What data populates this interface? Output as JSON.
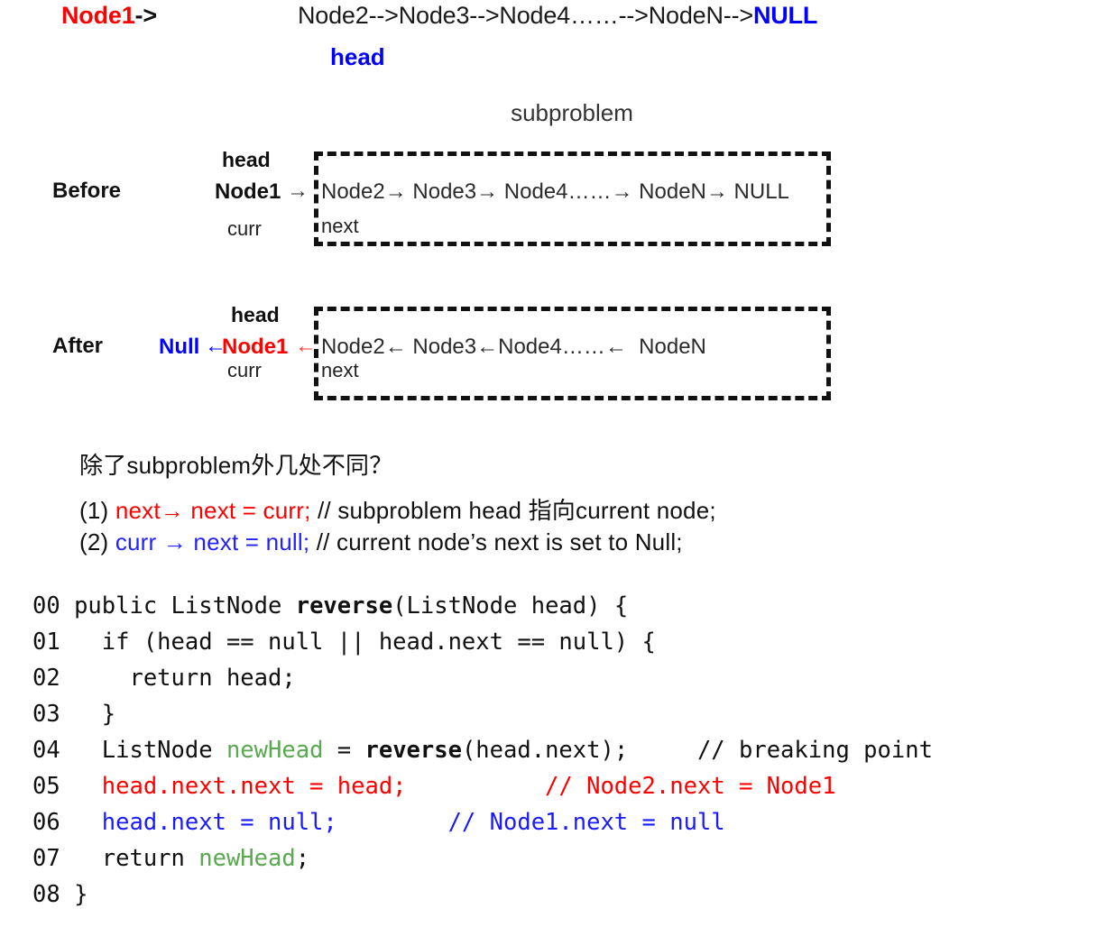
{
  "top_list": {
    "node1_label": "Node1",
    "node1_arrow": "->",
    "rest": "Node2-->Node3-->Node4……-->NodeN-->",
    "null_label": "NULL",
    "head_label": "head"
  },
  "diagram": {
    "subproblem_label": "subproblem",
    "before": {
      "row_label": "Before",
      "head_label": "head",
      "node1_label": "Node1",
      "arrow": "→",
      "curr_label": "curr",
      "chain": "Node2→ Node3→ Node4……→ NodeN→ NULL",
      "next_label": "next"
    },
    "after": {
      "row_label": "After",
      "head_label": "head",
      "null_label": "Null",
      "arrow_blue": "←",
      "node1_label": "Node1",
      "arrow_red": "←",
      "curr_label": "curr",
      "chain": "Node2← Node3←Node4……←  NodeN",
      "next_label": "next"
    }
  },
  "notes": {
    "question": "除了subproblem外几处不同？",
    "item1": {
      "index": "(1) ",
      "code": "next→ next = curr;",
      "comment": " // subproblem head 指向current node;"
    },
    "item2": {
      "index": "(2) ",
      "code": "curr → next = null;",
      "comment": " // current node’s next is set to Null;"
    }
  },
  "code": {
    "lines": [
      {
        "num": "00",
        "parts": [
          {
            "t": " public ListNode ",
            "c": "plain"
          },
          {
            "t": "reverse",
            "c": "bold"
          },
          {
            "t": "(ListNode head) {",
            "c": "plain"
          }
        ]
      },
      {
        "num": "01",
        "parts": [
          {
            "t": "   if (head == null || head.next == null) {",
            "c": "plain"
          }
        ]
      },
      {
        "num": "02",
        "parts": [
          {
            "t": "     return head;",
            "c": "plain"
          }
        ]
      },
      {
        "num": "03",
        "parts": [
          {
            "t": "   }",
            "c": "plain"
          }
        ]
      },
      {
        "num": "04",
        "parts": [
          {
            "t": "   ListNode ",
            "c": "plain"
          },
          {
            "t": "newHead",
            "c": "green"
          },
          {
            "t": " = ",
            "c": "plain"
          },
          {
            "t": "reverse",
            "c": "bold"
          },
          {
            "t": "(head.next);     // breaking point",
            "c": "plain"
          }
        ]
      },
      {
        "num": "05",
        "parts": [
          {
            "t": "   head.next.next = head;          // Node2.next = Node1",
            "c": "red"
          }
        ]
      },
      {
        "num": "06",
        "parts": [
          {
            "t": "   head.next = null;        // Node1.next = null",
            "c": "blue"
          }
        ]
      },
      {
        "num": "07",
        "parts": [
          {
            "t": "   return ",
            "c": "plain"
          },
          {
            "t": "newHead",
            "c": "green"
          },
          {
            "t": ";",
            "c": "plain"
          }
        ]
      },
      {
        "num": "08",
        "parts": [
          {
            "t": " }",
            "c": "plain"
          }
        ]
      }
    ]
  },
  "colors": {
    "red": "#ff0000",
    "blue": "#0000ff",
    "green": "#5aa84f",
    "black": "#111111"
  }
}
